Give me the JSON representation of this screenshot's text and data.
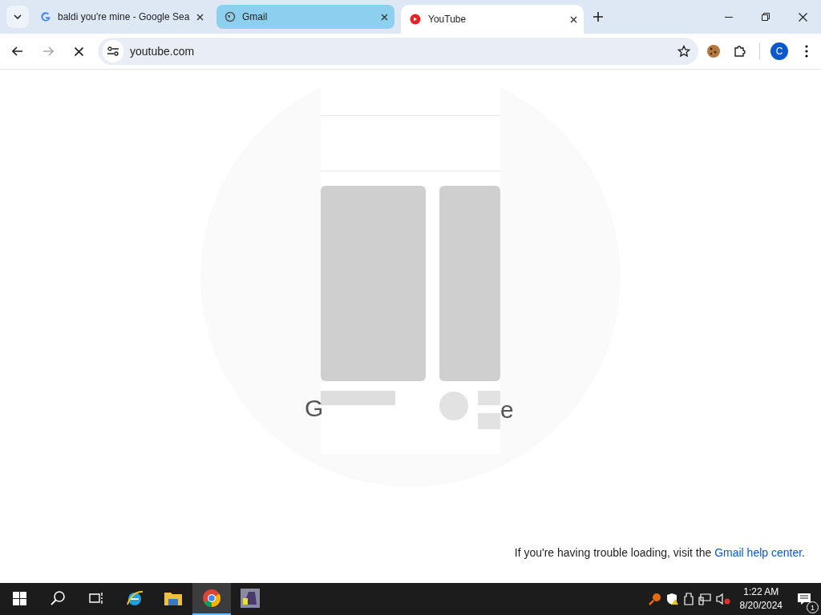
{
  "tabs": [
    {
      "title": "baldi you're mine - Google Sea",
      "kind": "google",
      "selected": false,
      "hovered": false
    },
    {
      "title": "Gmail",
      "kind": "globe",
      "selected": false,
      "hovered": true
    },
    {
      "title": "YouTube",
      "kind": "youtube",
      "selected": true,
      "hovered": false
    }
  ],
  "address_bar": {
    "value": "youtube.com"
  },
  "profile": {
    "initial": "C"
  },
  "page": {
    "logo_fragments": [
      "G",
      "e"
    ],
    "help_text": "If you're having trouble loading, visit the ",
    "help_link": "Gmail help center",
    "help_end": "."
  },
  "taskbar": {
    "apps": [
      {
        "kind": "ie",
        "selected": false
      },
      {
        "kind": "folder",
        "selected": false
      },
      {
        "kind": "chrome",
        "selected": true
      },
      {
        "kind": "game",
        "selected": false
      }
    ],
    "time": "1:22 AM",
    "date": "8/20/2024",
    "notification_count": "1"
  }
}
